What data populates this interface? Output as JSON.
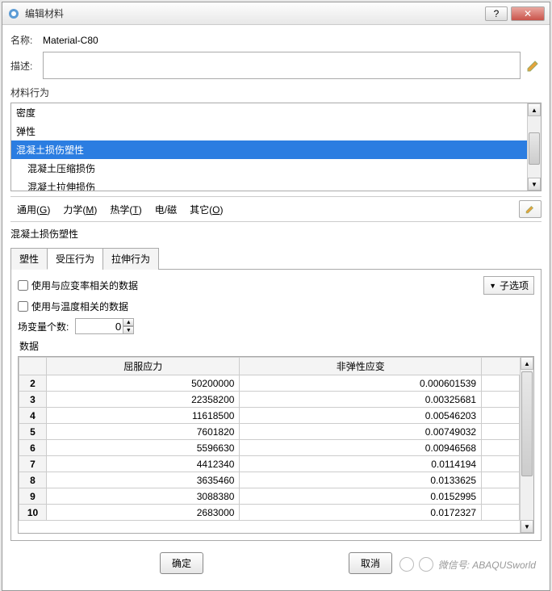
{
  "window": {
    "title": "编辑材料"
  },
  "name": {
    "label": "名称:",
    "value": "Material-C80"
  },
  "desc": {
    "label": "描述:"
  },
  "behaviors": {
    "title": "材料行为",
    "items": [
      {
        "label": "密度",
        "selected": false,
        "indent": 0
      },
      {
        "label": "弹性",
        "selected": false,
        "indent": 0
      },
      {
        "label": "混凝土损伤塑性",
        "selected": true,
        "indent": 0
      },
      {
        "label": "混凝土压缩损伤",
        "selected": false,
        "indent": 1
      },
      {
        "label": "混凝土拉伸损伤",
        "selected": false,
        "indent": 1
      }
    ]
  },
  "menus": {
    "general": {
      "text": "通用",
      "key": "G"
    },
    "mechanical": {
      "text": "力学",
      "key": "M"
    },
    "thermal": {
      "text": "热学",
      "key": "T"
    },
    "electrical": {
      "text": "电/磁"
    },
    "other": {
      "text": "其它",
      "key": "O"
    }
  },
  "subsection": {
    "title": "混凝土损伤塑性"
  },
  "tabs": [
    {
      "label": "塑性",
      "active": false
    },
    {
      "label": "受压行为",
      "active": true
    },
    {
      "label": "拉伸行为",
      "active": false
    }
  ],
  "options": {
    "strain_rate": "使用与应变率相关的数据",
    "temperature": "使用与温度相关的数据",
    "suboptions": "子选项",
    "field_vars_label": "场变量个数:",
    "field_vars_value": "0",
    "data_label": "数据"
  },
  "table": {
    "headers": {
      "col1": "屈服应力",
      "col2": "非弹性应变"
    },
    "rows": [
      {
        "n": "2",
        "a": "50200000",
        "b": "0.000601539"
      },
      {
        "n": "3",
        "a": "22358200",
        "b": "0.00325681"
      },
      {
        "n": "4",
        "a": "11618500",
        "b": "0.00546203"
      },
      {
        "n": "5",
        "a": "7601820",
        "b": "0.00749032"
      },
      {
        "n": "6",
        "a": "5596630",
        "b": "0.00946568"
      },
      {
        "n": "7",
        "a": "4412340",
        "b": "0.0114194"
      },
      {
        "n": "8",
        "a": "3635460",
        "b": "0.0133625"
      },
      {
        "n": "9",
        "a": "3088380",
        "b": "0.0152995"
      },
      {
        "n": "10",
        "a": "2683000",
        "b": "0.0172327"
      }
    ]
  },
  "buttons": {
    "ok": "确定",
    "cancel": "取消"
  },
  "watermark": "微信号: ABAQUSworld",
  "chart_data": {
    "type": "table",
    "title": "受压行为 数据",
    "columns": [
      "屈服应力",
      "非弹性应变"
    ],
    "rows": [
      [
        50200000,
        0.000601539
      ],
      [
        22358200,
        0.00325681
      ],
      [
        11618500,
        0.00546203
      ],
      [
        7601820,
        0.00749032
      ],
      [
        5596630,
        0.00946568
      ],
      [
        4412340,
        0.0114194
      ],
      [
        3635460,
        0.0133625
      ],
      [
        3088380,
        0.0152995
      ],
      [
        2683000,
        0.0172327
      ]
    ]
  }
}
